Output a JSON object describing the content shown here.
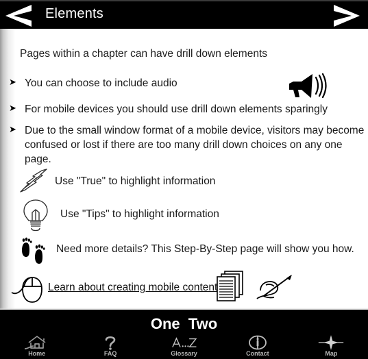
{
  "header": {
    "title": "Elements",
    "prev_label": "Previous page",
    "next_label": "Next page",
    "prev_icon": "chevron-left-icon",
    "next_icon": "chevron-right-icon",
    "background": "#000000",
    "text_color": "#ffffff"
  },
  "content": {
    "intro": "Pages within a chapter can have drill down elements",
    "bullets": [
      "You can choose to include audio",
      "For mobile devices you should use drill down elements sparingly",
      "Due to the small window format of a mobile device, visitors may become confused or lost if there are too many drill down choices on any one page."
    ],
    "audio_icon": "megaphone-icon",
    "rows": [
      {
        "icon": "lightning-bolt-icon",
        "text": "Use \"True\" to highlight information"
      },
      {
        "icon": "lightbulb-icon",
        "text": "Use \"Tips\" to highlight information"
      },
      {
        "icon": "footprints-icon",
        "text": "Need more details? This Step-By-Step page will show you how."
      }
    ],
    "link": {
      "icon": "computer-mouse-icon",
      "text": "Learn about creating mobile content",
      "trailing_icons": [
        "stacked-documents-icon",
        "hand-writing-pen-icon"
      ]
    },
    "background": "#ffffff",
    "text_color": "#1a1a1a"
  },
  "footer": {
    "chapters": [
      {
        "label": "One",
        "color": "#ffffff"
      },
      {
        "label": "Two",
        "color": "#ffffff"
      }
    ],
    "nav": [
      {
        "label": "Home",
        "icon": "house-icon"
      },
      {
        "label": "FAQ",
        "icon": "question-mark-icon"
      },
      {
        "label": "Glossary",
        "icon": "a-to-z-icon"
      },
      {
        "label": "Contact",
        "icon": "info-circle-icon"
      },
      {
        "label": "Map",
        "icon": "compass-star-icon"
      }
    ],
    "background": "#000000",
    "label_color": "#b8b8b8"
  }
}
